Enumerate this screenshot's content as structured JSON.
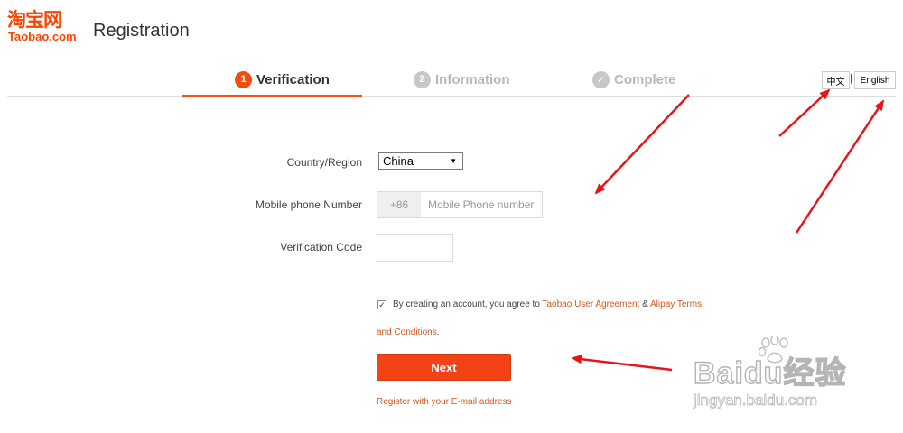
{
  "header": {
    "logo_cn": "淘宝网",
    "logo_en": "Taobao.com",
    "title": "Registration"
  },
  "steps": [
    {
      "num": "1",
      "label": "Verification",
      "state": "active"
    },
    {
      "num": "2",
      "label": "Information",
      "state": "inactive"
    },
    {
      "num": "✓",
      "label": "Complete",
      "state": "inactive"
    }
  ],
  "language": {
    "chinese": "中文",
    "separator": "|",
    "english": "English"
  },
  "form": {
    "country_label": "Country/Region",
    "country_value": "China",
    "phone_label": "Mobile phone Number",
    "phone_prefix": "+86",
    "phone_placeholder": "Mobile Phone number",
    "code_label": "Verification Code",
    "code_value": ""
  },
  "agreement": {
    "checked": true,
    "text_prefix": "By creating an account, you agree to ",
    "link1": "Taobao User Agreement",
    "amp": " & ",
    "link2": "Alipay Terms",
    "link2_cont": "and Conditions",
    "period": "."
  },
  "actions": {
    "next_label": "Next",
    "email_link": "Register with your E-mail address"
  },
  "watermark": {
    "main": "Baidu经验",
    "sub": "jingyan.baidu.com"
  },
  "colors": {
    "brand": "#ff4400",
    "active_step": "#f04d10",
    "button": "#f24216",
    "link": "#d0581f",
    "annotation_arrow": "#e8141b"
  }
}
